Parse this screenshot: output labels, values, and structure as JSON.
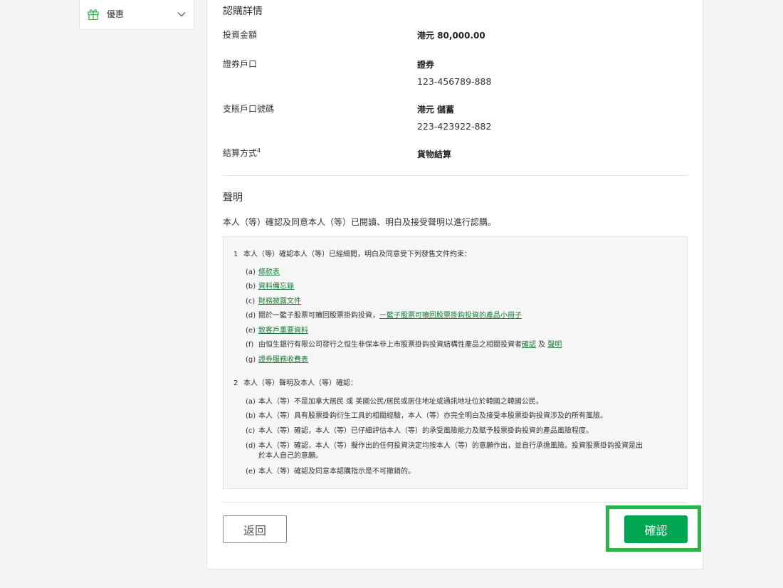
{
  "sidebar": {
    "offer_label": "優惠"
  },
  "subscription": {
    "title": "認購詳情",
    "rows": [
      {
        "label": "投資金額",
        "value_prefix": "港元 ",
        "value_bold": "80,000.00"
      },
      {
        "label": "證券戶口",
        "value_bold": "證券",
        "sub": "123-456789-888"
      },
      {
        "label": "支賬戶口號碼",
        "value_bold": "港元 儲蓄",
        "sub": "223-423922-882"
      },
      {
        "label": "結算方式",
        "sup": "4",
        "value_bold": "貨物結算"
      }
    ]
  },
  "declaration": {
    "title": "聲明",
    "intro": "本人（等）確認及同意本人（等）已閱讀、明白及接受聲明以進行認購。",
    "section1": {
      "num": "1",
      "heading": "本人（等）確認本人（等）已經細閱，明白及同意受下列發售文件約束：",
      "a": {
        "mark": "(a)",
        "link": "條款表"
      },
      "b": {
        "mark": "(b)",
        "link": "資料備忘錄"
      },
      "c": {
        "mark": "(c)",
        "link": "財務披露文件"
      },
      "d": {
        "mark": "(d)",
        "text": "關於一籃子股票可贖回股票掛鈎投資，",
        "link": "一籃子股票可贖回股票掛鈎投資的產品小冊子"
      },
      "e": {
        "mark": "(e)",
        "link": "致客戶重要資料"
      },
      "f": {
        "mark": "(f)",
        "text": "由恒生銀行有限公司發行之恒生非保本非上市股票掛鈎投資結構性產品之相關投資者",
        "link1": "確認",
        "mid": " 及 ",
        "link2": "聲明"
      },
      "g": {
        "mark": "(g)",
        "link": "證券服務收費表"
      }
    },
    "section2": {
      "num": "2",
      "heading": "本人（等）聲明及本人（等）確認：",
      "a": {
        "mark": "(a)",
        "text": "本人（等）不是加拿大居民 或 美國公民/居民或居住地址或通訊地址位於韓國之韓國公民。"
      },
      "b": {
        "mark": "(b)",
        "text": "本人（等）具有股票掛鈎衍生工具的相關經驗，本人（等）亦完全明白及接受本股票掛鈎投資涉及的所有風險。"
      },
      "c": {
        "mark": "(c)",
        "text": "本人（等）確認，本人（等）已仔細評估本人（等）的承受風險能力及賦予股票掛鈎投資的產品風險程度。"
      },
      "d": {
        "mark": "(d)",
        "text1": "本人（等）確認，本人（等）擬作出的任何投資決定均按本人（等）的意願作出，並自行承擔風險。投資股票掛鈎投資是出",
        "text2": "於本人自己的意願。"
      },
      "e": {
        "mark": "(e)",
        "text": "本人（等）確認及同意本認購指示是不可撤銷的。"
      }
    }
  },
  "actions": {
    "back_label": "返回",
    "confirm_label": "確認"
  },
  "colors": {
    "brand_green": "#00a651",
    "link_green": "#1a7a36",
    "highlight_green": "#2db34a"
  }
}
